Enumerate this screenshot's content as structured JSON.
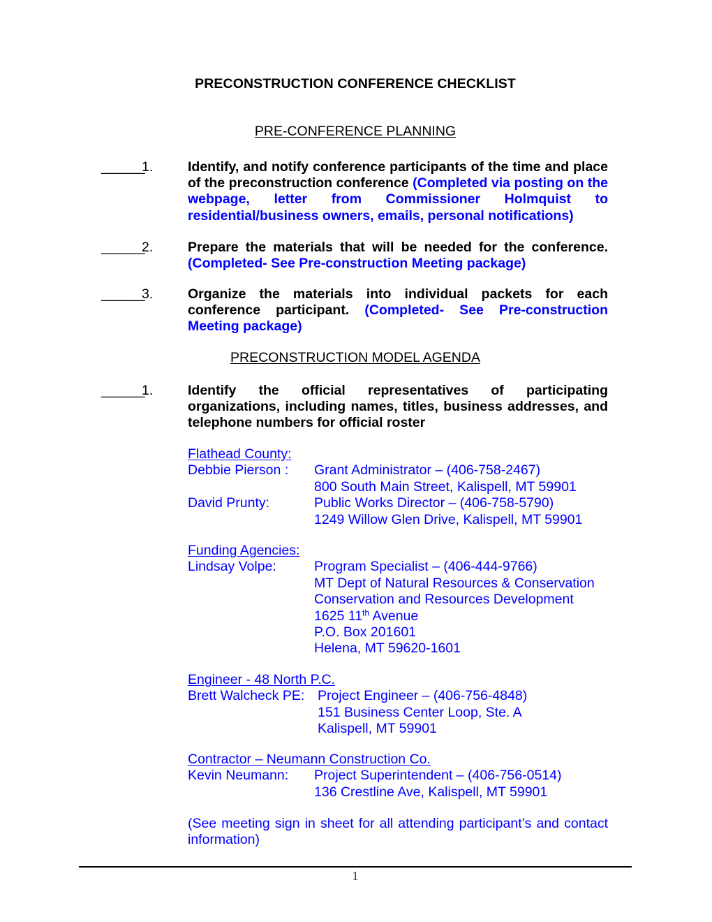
{
  "document": {
    "title": "PRECONSTRUCTION CONFERENCE CHECKLIST",
    "page_number": "1",
    "accent_color": "#0000FF",
    "text_color": "#000000"
  },
  "sections": {
    "planning": {
      "heading": "PRE-CONFERENCE PLANNING",
      "items": [
        {
          "blank": "______",
          "number": "1.",
          "text_black": "Identify, and notify conference participants of the time and place of the preconstruction conference ",
          "text_blue": "(Completed via posting on the webpage, letter from Commissioner Holmquist to residential/business owners, emails, personal notifications)"
        },
        {
          "blank": "______",
          "number": "2.",
          "text_black": "Prepare the materials that will be needed for the conference. ",
          "text_blue": "(Completed- See Pre-construction Meeting package)"
        },
        {
          "blank": "______",
          "number": "3.",
          "text_black": "Organize the materials into individual packets for each conference participant.  ",
          "text_blue": "(Completed- See Pre-construction Meeting package)"
        }
      ]
    },
    "agenda": {
      "heading": "PRECONSTRUCTION MODEL AGENDA",
      "items": [
        {
          "blank": "______",
          "number": "1.",
          "text_black": "Identify the official representatives of participating organizations, including names, titles, business addresses, and telephone numbers for official roster",
          "text_blue": ""
        }
      ]
    }
  },
  "contacts": [
    {
      "group_heading": "Flathead County:",
      "people": [
        {
          "name": "Debbie Pierson :",
          "lines": "Grant Administrator – (406-758-2467)\n800 South Main Street, Kalispell, MT 59901"
        },
        {
          "name": "David Prunty:",
          "lines": "Public Works Director – (406-758-5790)\n1249 Willow Glen Drive, Kalispell, MT 59901"
        }
      ]
    },
    {
      "group_heading": "Funding Agencies:",
      "people": [
        {
          "name": "Lindsay Volpe:",
          "lines_pre": "Program Specialist – (406-444-9766)\nMT Dept of Natural Resources & Conservation\nConservation and Resources Development\n1625 11",
          "superscript": "th",
          "lines_post": " Avenue\nP.O. Box 201601\nHelena, MT 59620-1601"
        }
      ]
    },
    {
      "group_heading": "Engineer - 48 North P.C.",
      "people": [
        {
          "name": "Brett Walcheck PE:",
          "lines": "Project Engineer – (406-756-4848)\n151 Business Center Loop, Ste. A\nKalispell, MT 59901"
        }
      ]
    },
    {
      "group_heading": "Contractor – Neumann Construction Co.",
      "people": [
        {
          "name": "Kevin Neumann:",
          "lines": "Project Superintendent – (406-756-0514)\n136 Crestline Ave, Kalispell, MT 59901"
        }
      ]
    }
  ],
  "closing_note": "(See meeting sign in sheet for all attending participant’s and contact information)"
}
